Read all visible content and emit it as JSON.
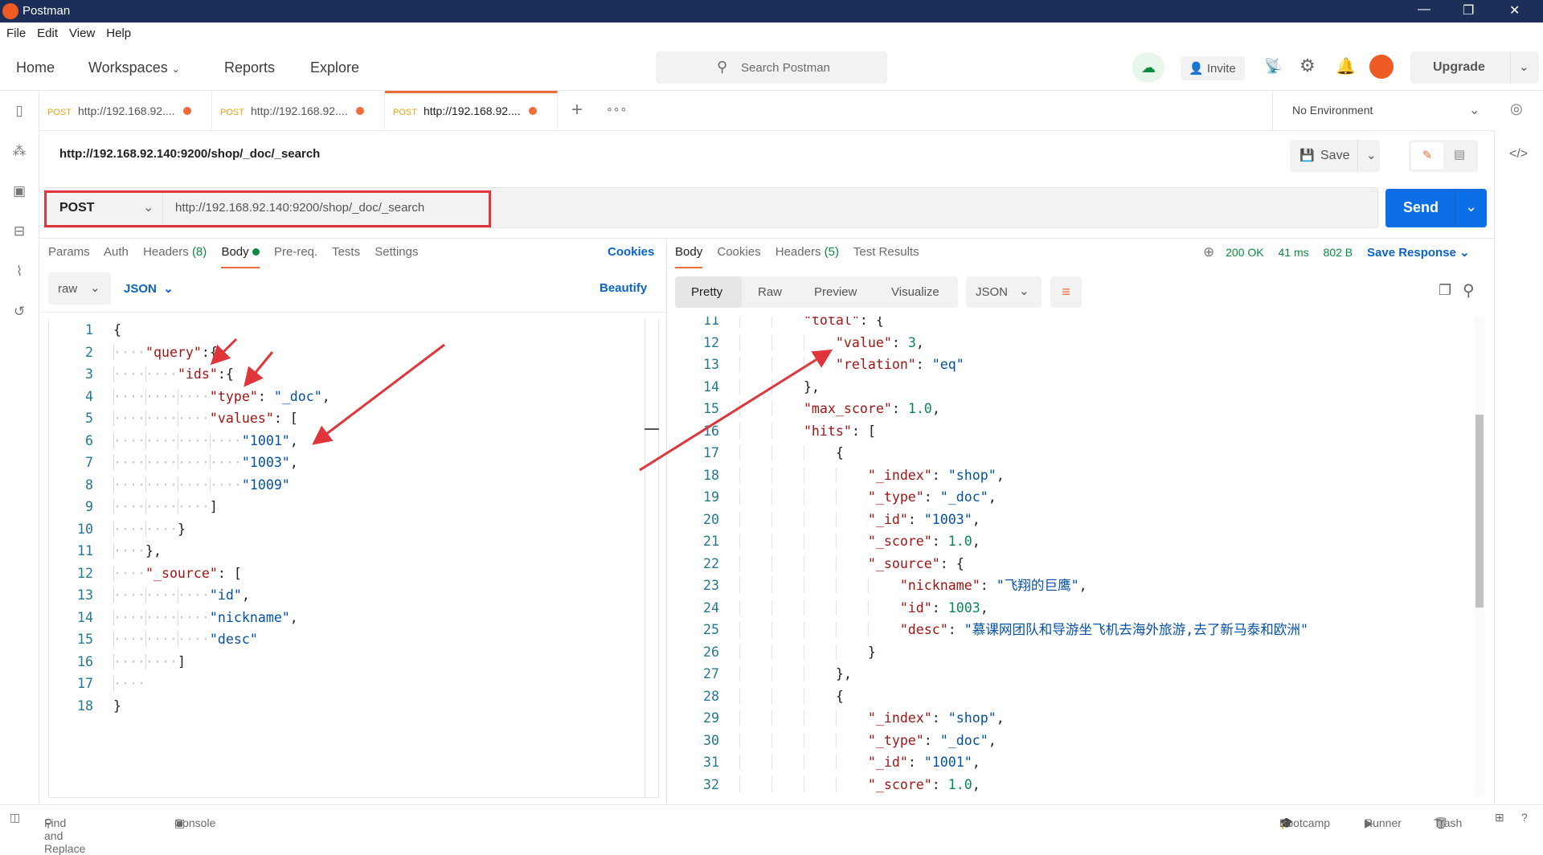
{
  "window": {
    "title": "Postman",
    "minimize": "—",
    "restore": "❐",
    "close": "✕"
  },
  "menu": [
    "File",
    "Edit",
    "View",
    "Help"
  ],
  "nav": {
    "home": "Home",
    "workspaces": "Workspaces",
    "reports": "Reports",
    "explore": "Explore",
    "search_placeholder": "Search Postman",
    "invite": "Invite",
    "upgrade": "Upgrade"
  },
  "tabs": [
    {
      "method": "POST",
      "label": "http://192.168.92...."
    },
    {
      "method": "POST",
      "label": "http://192.168.92...."
    },
    {
      "method": "POST",
      "label": "http://192.168.92....",
      "active": true
    }
  ],
  "environment": "No Environment",
  "request": {
    "name": "http://192.168.92.140:9200/shop/_doc/_search",
    "method": "POST",
    "url": "http://192.168.92.140:9200/shop/_doc/_search",
    "save": "Save",
    "send": "Send",
    "tabs": [
      "Params",
      "Auth",
      "Headers",
      "Body",
      "Pre-req.",
      "Tests",
      "Settings"
    ],
    "headers_count": "(8)",
    "cookies": "Cookies",
    "body_mode": "raw",
    "body_lang": "JSON",
    "beautify": "Beautify"
  },
  "request_body": [
    [
      [
        "p",
        "{"
      ]
    ],
    [
      [
        "w",
        "    "
      ],
      [
        "k",
        "\"query\""
      ],
      [
        "p",
        ":{"
      ]
    ],
    [
      [
        "w",
        "        "
      ],
      [
        "k",
        "\"ids\""
      ],
      [
        "p",
        ":{"
      ]
    ],
    [
      [
        "w",
        "            "
      ],
      [
        "k",
        "\"type\""
      ],
      [
        "p",
        ": "
      ],
      [
        "s",
        "\"_doc\""
      ],
      [
        "p",
        ","
      ]
    ],
    [
      [
        "w",
        "            "
      ],
      [
        "k",
        "\"values\""
      ],
      [
        "p",
        ": ["
      ]
    ],
    [
      [
        "w",
        "                "
      ],
      [
        "s",
        "\"1001\""
      ],
      [
        "p",
        ","
      ]
    ],
    [
      [
        "w",
        "                "
      ],
      [
        "s",
        "\"1003\""
      ],
      [
        "p",
        ","
      ]
    ],
    [
      [
        "w",
        "                "
      ],
      [
        "s",
        "\"1009\""
      ]
    ],
    [
      [
        "w",
        "            "
      ],
      [
        "p",
        "]"
      ]
    ],
    [
      [
        "w",
        "        "
      ],
      [
        "p",
        "}"
      ]
    ],
    [
      [
        "w",
        "    "
      ],
      [
        "p",
        "},"
      ]
    ],
    [
      [
        "w",
        "    "
      ],
      [
        "k",
        "\"_source\""
      ],
      [
        "p",
        ": ["
      ]
    ],
    [
      [
        "w",
        "            "
      ],
      [
        "s",
        "\"id\""
      ],
      [
        "p",
        ","
      ]
    ],
    [
      [
        "w",
        "            "
      ],
      [
        "s",
        "\"nickname\""
      ],
      [
        "p",
        ","
      ]
    ],
    [
      [
        "w",
        "            "
      ],
      [
        "s",
        "\"desc\""
      ]
    ],
    [
      [
        "w",
        "        "
      ],
      [
        "p",
        "]"
      ]
    ],
    [
      [
        "w",
        "    "
      ]
    ],
    [
      [
        "p",
        "}"
      ]
    ]
  ],
  "response": {
    "tabs": [
      "Body",
      "Cookies",
      "Headers",
      "Test Results"
    ],
    "headers_count": "(5)",
    "status": "200 OK",
    "time": "41 ms",
    "size": "802 B",
    "save_response": "Save Response",
    "views": [
      "Pretty",
      "Raw",
      "Preview",
      "Visualize"
    ],
    "format": "JSON",
    "first_line": 11,
    "lines": [
      [
        [
          "w",
          "        "
        ],
        [
          "k",
          "\"total\""
        ],
        [
          "p",
          ": {"
        ]
      ],
      [
        [
          "w",
          "            "
        ],
        [
          "k",
          "\"value\""
        ],
        [
          "p",
          ": "
        ],
        [
          "n",
          "3"
        ],
        [
          "p",
          ","
        ]
      ],
      [
        [
          "w",
          "            "
        ],
        [
          "k",
          "\"relation\""
        ],
        [
          "p",
          ": "
        ],
        [
          "s",
          "\"eq\""
        ]
      ],
      [
        [
          "w",
          "        "
        ],
        [
          "p",
          "},"
        ]
      ],
      [
        [
          "w",
          "        "
        ],
        [
          "k",
          "\"max_score\""
        ],
        [
          "p",
          ": "
        ],
        [
          "n",
          "1.0"
        ],
        [
          "p",
          ","
        ]
      ],
      [
        [
          "w",
          "        "
        ],
        [
          "k",
          "\"hits\""
        ],
        [
          "p",
          ": ["
        ]
      ],
      [
        [
          "w",
          "            "
        ],
        [
          "p",
          "{"
        ]
      ],
      [
        [
          "w",
          "                "
        ],
        [
          "k",
          "\"_index\""
        ],
        [
          "p",
          ": "
        ],
        [
          "s",
          "\"shop\""
        ],
        [
          "p",
          ","
        ]
      ],
      [
        [
          "w",
          "                "
        ],
        [
          "k",
          "\"_type\""
        ],
        [
          "p",
          ": "
        ],
        [
          "s",
          "\"_doc\""
        ],
        [
          "p",
          ","
        ]
      ],
      [
        [
          "w",
          "                "
        ],
        [
          "k",
          "\"_id\""
        ],
        [
          "p",
          ": "
        ],
        [
          "s",
          "\"1003\""
        ],
        [
          "p",
          ","
        ]
      ],
      [
        [
          "w",
          "                "
        ],
        [
          "k",
          "\"_score\""
        ],
        [
          "p",
          ": "
        ],
        [
          "n",
          "1.0"
        ],
        [
          "p",
          ","
        ]
      ],
      [
        [
          "w",
          "                "
        ],
        [
          "k",
          "\"_source\""
        ],
        [
          "p",
          ": {"
        ]
      ],
      [
        [
          "w",
          "                    "
        ],
        [
          "k",
          "\"nickname\""
        ],
        [
          "p",
          ": "
        ],
        [
          "s",
          "\"飞翔的巨鹰\""
        ],
        [
          "p",
          ","
        ]
      ],
      [
        [
          "w",
          "                    "
        ],
        [
          "k",
          "\"id\""
        ],
        [
          "p",
          ": "
        ],
        [
          "n",
          "1003"
        ],
        [
          "p",
          ","
        ]
      ],
      [
        [
          "w",
          "                    "
        ],
        [
          "k",
          "\"desc\""
        ],
        [
          "p",
          ": "
        ],
        [
          "s",
          "\"慕课网团队和导游坐飞机去海外旅游,去了新马泰和欧洲\""
        ]
      ],
      [
        [
          "w",
          "                "
        ],
        [
          "p",
          "}"
        ]
      ],
      [
        [
          "w",
          "            "
        ],
        [
          "p",
          "},"
        ]
      ],
      [
        [
          "w",
          "            "
        ],
        [
          "p",
          "{"
        ]
      ],
      [
        [
          "w",
          "                "
        ],
        [
          "k",
          "\"_index\""
        ],
        [
          "p",
          ": "
        ],
        [
          "s",
          "\"shop\""
        ],
        [
          "p",
          ","
        ]
      ],
      [
        [
          "w",
          "                "
        ],
        [
          "k",
          "\"_type\""
        ],
        [
          "p",
          ": "
        ],
        [
          "s",
          "\"_doc\""
        ],
        [
          "p",
          ","
        ]
      ],
      [
        [
          "w",
          "                "
        ],
        [
          "k",
          "\"_id\""
        ],
        [
          "p",
          ": "
        ],
        [
          "s",
          "\"1001\""
        ],
        [
          "p",
          ","
        ]
      ],
      [
        [
          "w",
          "                "
        ],
        [
          "k",
          "\"_score\""
        ],
        [
          "p",
          ": "
        ],
        [
          "n",
          "1.0"
        ],
        [
          "p",
          ","
        ]
      ]
    ]
  },
  "statusbar": {
    "find": "Find and Replace",
    "console": "Console",
    "bootcamp": "Bootcamp",
    "runner": "Runner",
    "trash": "Trash"
  },
  "colors": {
    "accent": "#f26b3a",
    "send": "#0c6fe6",
    "annotation": "#e0353a",
    "status_ok": "#0a8a3f"
  }
}
